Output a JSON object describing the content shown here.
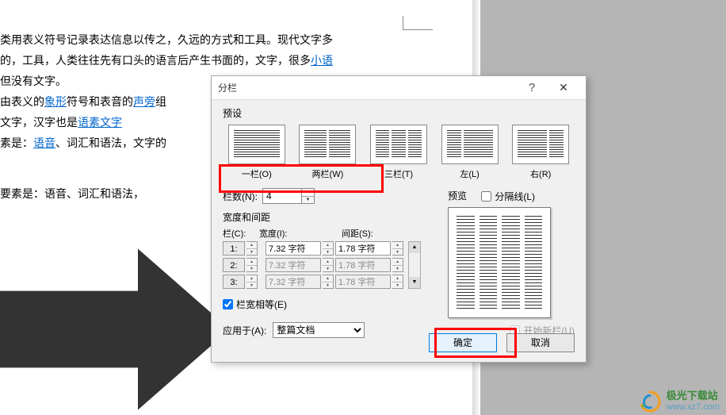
{
  "document": {
    "line1_a": "类用表义符号记录表达信息以传之，久远的方式和工具。现代文字多",
    "line2_a": "的，工具，人类往往先有口头的语言后产生书面的，文字，很多",
    "line2_link": "小语",
    "line3": "但没有文字。",
    "line4_a": "由表义的",
    "line4_link1": "象形",
    "line4_b": "符号和表音的",
    "line4_link2": "声旁",
    "line4_c": "组",
    "line5_a": "文字，汉字也是",
    "line5_link": "语素文字",
    "line6_a": "素是：",
    "line6_link": "语音",
    "line6_b": "、词汇和语法，文字的",
    "line7": "要素是：语音、词汇和语法，"
  },
  "dialog": {
    "title": "分栏",
    "help": "?",
    "close": "✕",
    "preset_label": "预设",
    "presets": [
      {
        "label": "一栏(O)",
        "cols": 1
      },
      {
        "label": "两栏(W)",
        "cols": 2
      },
      {
        "label": "三栏(T)",
        "cols": 3
      },
      {
        "label": "左(L)",
        "cols": 2
      },
      {
        "label": "右(R)",
        "cols": 2
      }
    ],
    "cols_label": "栏数(N):",
    "cols_value": "4",
    "separator_label": "分隔线(L)",
    "wg_label": "宽度和间距",
    "preview_label": "预览",
    "col_header": "栏(C):",
    "width_header": "宽度(I):",
    "spacing_header": "间距(S):",
    "rows": [
      {
        "idx": "1:",
        "w": "7.32 字符",
        "s": "1.78 字符",
        "enabled": true
      },
      {
        "idx": "2:",
        "w": "7.32 字符",
        "s": "1.78 字符",
        "enabled": false
      },
      {
        "idx": "3:",
        "w": "7.32 字符",
        "s": "1.78 字符",
        "enabled": false
      }
    ],
    "eq_label": "栏宽相等(E)",
    "apply_label": "应用于(A):",
    "apply_value": "整篇文档",
    "newcol_label": "开始新栏(U)",
    "ok": "确定",
    "cancel": "取消"
  },
  "watermark": {
    "cn": "极光下载站",
    "url": "www.xz7.com"
  }
}
